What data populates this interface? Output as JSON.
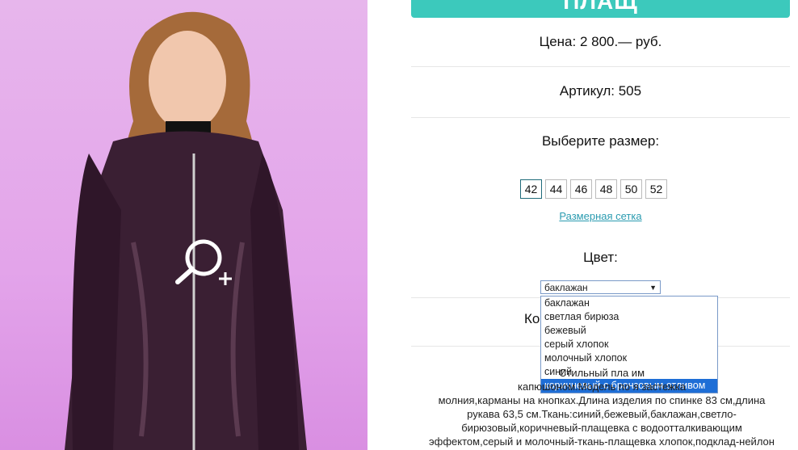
{
  "product": {
    "title": "ПЛАЩ",
    "price": "Цена: 2 800.— руб.",
    "sku": "Артикул: 505",
    "size_label": "Выберите размер:",
    "sizes": [
      "42",
      "44",
      "46",
      "48",
      "50",
      "52"
    ],
    "size_chart_link": "Размерная сетка",
    "color_label": "Цвет:",
    "color_selected": "баклажан",
    "color_options": [
      "баклажан",
      "светлая бирюза",
      "бежевый",
      "серый хлопок",
      "молочный хлопок",
      "синий",
      "коричневый с бронзовым отливом"
    ],
    "qty_label_partial": "Ко",
    "description_lines": [
      "Стильный пла                                                 им",
      "капюшоном.Модель по                                    я застежка",
      "молния,карманы на кнопках.Длина изделия по спинке 83 см,длина",
      "рукава 63,5 см.Ткань:синий,бежевый,баклажан,светло-",
      "бирюзовый,коричневый-плащевка с водоотталкивающим",
      "эффектом,серый и молочный-ткань-плащевка хлопок,подклад-нейлон"
    ]
  },
  "colors": {
    "accent": "#3cc9bc",
    "link": "#2a9bb0",
    "highlight": "#1e6ed6"
  },
  "icons": {
    "zoom": "zoom-plus-icon",
    "dropdown": "chevron-down-icon"
  }
}
